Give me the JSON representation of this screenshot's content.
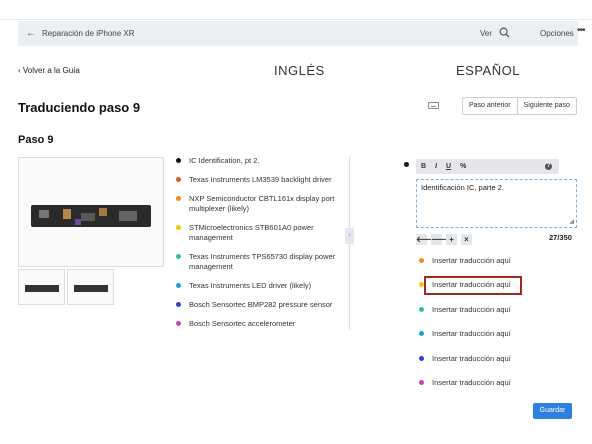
{
  "header": {
    "back_icon": "arrow-left-icon",
    "title": "Reparación de iPhone XR",
    "view_label": "Ver",
    "search_icon": "search-icon",
    "options_label": "Opciones",
    "more_icon": "more-dots-icon"
  },
  "nav": {
    "back_to_guide": "Volver a la Guía",
    "col_english": "INGLÉS",
    "col_spanish": "ESPAÑOL"
  },
  "step": {
    "heading": "Traduciendo paso 9",
    "prev_label": "Paso anterior",
    "next_label": "Siguiente paso",
    "keyboard_icon": "keyboard-icon",
    "paso_label": "Paso 9"
  },
  "english": {
    "bullets": [
      {
        "text": "IC Identification, pt 2.",
        "color": "#111111"
      },
      {
        "text": "Texas Instruments LM3539 backlight driver",
        "color": "#e0582a"
      },
      {
        "text": "NXP Semiconductor CBTL161x display port multiplexer (likely)",
        "color": "#f08a1c"
      },
      {
        "text": "STMicroelectronics STB601A0 power management",
        "color": "#f2c613"
      },
      {
        "text": "Texas Instruments TPS65730 display power management",
        "color": "#2ec28a"
      },
      {
        "text": "Texas Instruments LED driver (likely)",
        "color": "#19a3c4"
      },
      {
        "text": "Bosch Sensortec BMP282 pressure sensor",
        "color": "#2c3ed6"
      },
      {
        "text": "Bosch Sensortec accelerometer",
        "color": "#c042b5"
      }
    ]
  },
  "spanish": {
    "toolbar": {
      "bold": "B",
      "italic": "I",
      "underline": "U",
      "link": "%",
      "help": "?"
    },
    "editor_value": "Identificación IC, parte 2.",
    "counter": "27/350",
    "arrows": [
      "🡐",
      "🡒",
      "+",
      "×"
    ],
    "placeholders": [
      {
        "text": "Insertar traducción aquí",
        "color": "#f08a1c"
      },
      {
        "text": "Insertar traducción aquí",
        "color": "#f2c613"
      },
      {
        "text": "Insertar traducción aquí",
        "color": "#2ec28a"
      },
      {
        "text": "Insertar traducción aquí",
        "color": "#19a3c4"
      },
      {
        "text": "Insertar traducción aquí",
        "color": "#2c3ed6"
      },
      {
        "text": "Insertar traducción aquí",
        "color": "#c042b5"
      }
    ],
    "save_label": "Guardar"
  }
}
